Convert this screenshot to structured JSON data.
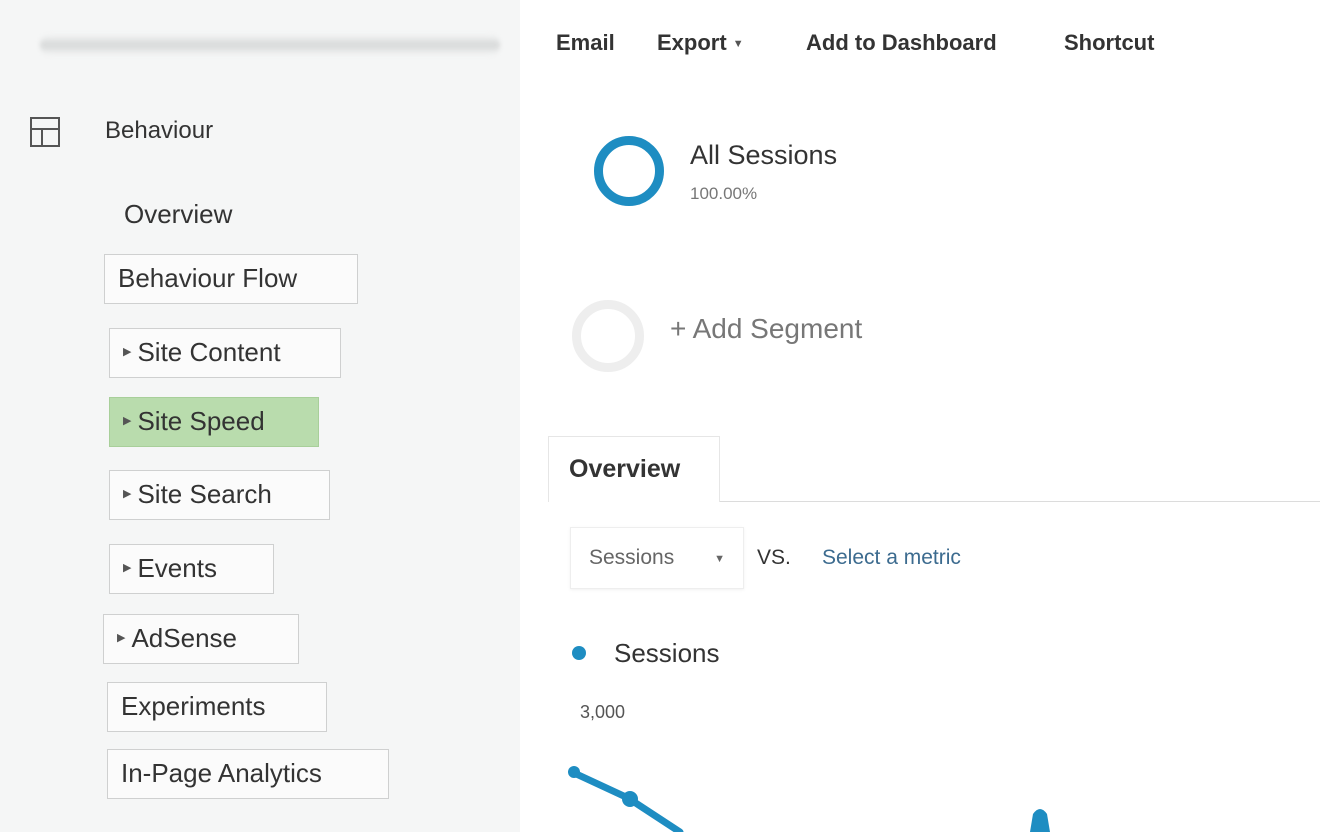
{
  "toolbar": {
    "email": "Email",
    "export": "Export",
    "add_to_dashboard": "Add to Dashboard",
    "shortcut": "Shortcut"
  },
  "sidebar": {
    "section_label": "Behaviour",
    "items": [
      {
        "label": "Overview"
      },
      {
        "label": "Behaviour Flow"
      },
      {
        "label": "Site Content"
      },
      {
        "label": "Site Speed"
      },
      {
        "label": "Site Search"
      },
      {
        "label": "Events"
      },
      {
        "label": "AdSense"
      },
      {
        "label": "Experiments"
      },
      {
        "label": "In-Page Analytics"
      }
    ],
    "active_item": "Site Speed"
  },
  "segments": {
    "all_sessions": {
      "title": "All Sessions",
      "percent": "100.00%"
    },
    "add_segment": "+ Add Segment"
  },
  "tabs": {
    "overview": "Overview"
  },
  "metrics": {
    "primary": "Sessions",
    "vs": "VS.",
    "select_metric": "Select a metric"
  },
  "chart": {
    "legend": "Sessions",
    "y_tick": "3,000"
  },
  "colors": {
    "accent": "#1e8dc2",
    "active_nav": "#b9dcad",
    "link": "#3c6b8f"
  },
  "chart_data": {
    "type": "line",
    "series": [
      {
        "name": "Sessions"
      }
    ],
    "yticks": [
      "3,000"
    ]
  }
}
